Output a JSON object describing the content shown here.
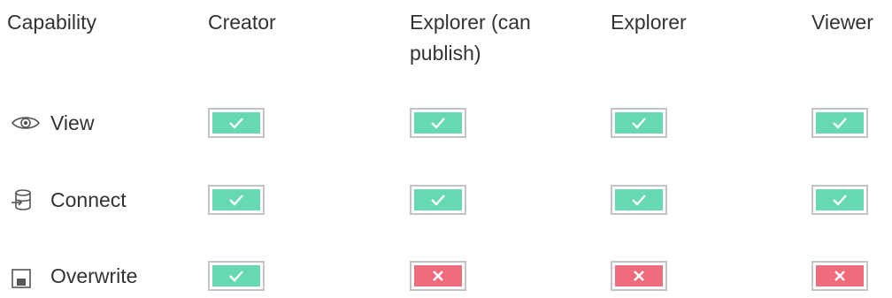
{
  "columns": {
    "capability": "Capability",
    "creator": "Creator",
    "explorer_publish": "Explorer (can publish)",
    "explorer": "Explorer",
    "viewer": "Viewer"
  },
  "rows": [
    {
      "label": "View",
      "icon": "eye-icon",
      "creator": "allowed",
      "explorer_publish": "allowed",
      "explorer": "allowed",
      "viewer": "allowed"
    },
    {
      "label": "Connect",
      "icon": "database-connect-icon",
      "creator": "allowed",
      "explorer_publish": "allowed",
      "explorer": "allowed",
      "viewer": "allowed"
    },
    {
      "label": "Overwrite",
      "icon": "save-icon",
      "creator": "allowed",
      "explorer_publish": "denied",
      "explorer": "denied",
      "viewer": "denied"
    }
  ],
  "colors": {
    "allowed": "#66d9b1",
    "denied": "#f06b7b",
    "border": "#c4c4c4",
    "text": "#333333"
  }
}
